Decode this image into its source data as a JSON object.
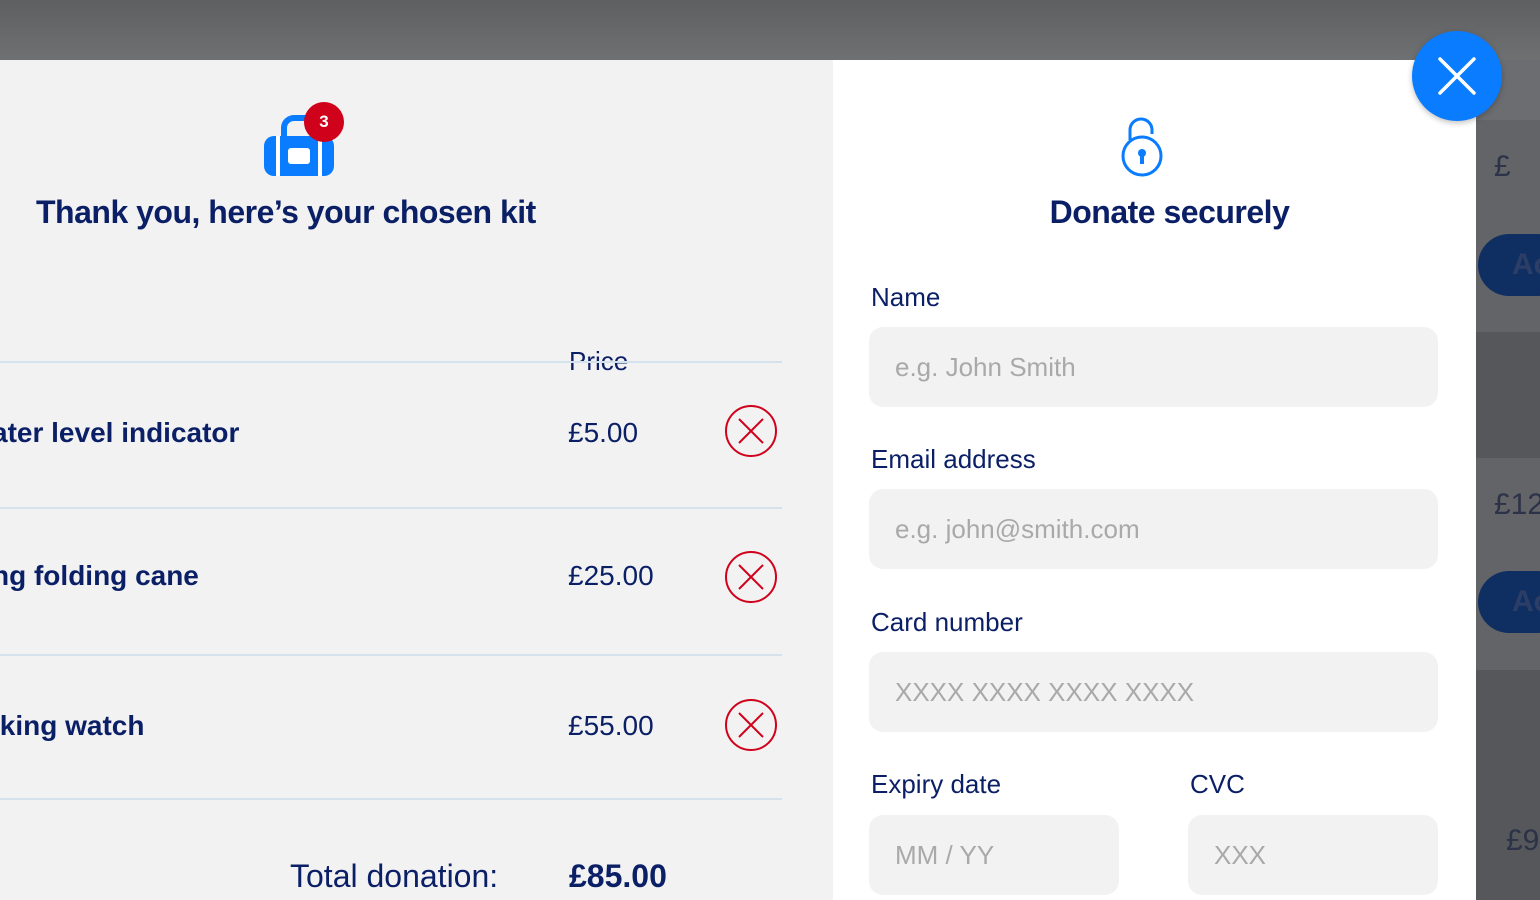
{
  "background": {
    "texts": [
      "£",
      "£12",
      "£9"
    ],
    "buttons": [
      "Ac",
      "Ac"
    ]
  },
  "kit": {
    "badge_count": "3",
    "title": "Thank you, here’s your chosen kit",
    "price_header": "Price",
    "items": [
      {
        "name": "ater level indicator",
        "price": "£5.00"
      },
      {
        "name": "ng folding cane",
        "price": "£25.00"
      },
      {
        "name": "lking watch",
        "price": "£55.00"
      }
    ],
    "total_label": "Total donation:",
    "total_value": "£85.00"
  },
  "donate": {
    "title": "Donate securely",
    "name_label": "Name",
    "name_placeholder": "e.g. John Smith",
    "email_label": "Email address",
    "email_placeholder": "e.g. john@smith.com",
    "card_label": "Card number",
    "card_placeholder": "XXXX XXXX XXXX XXXX",
    "expiry_label": "Expiry date",
    "expiry_placeholder": "MM / YY",
    "cvc_label": "CVC",
    "cvc_placeholder": "XXX"
  },
  "icons": {
    "close": "close-icon",
    "remove": "remove-circle-icon",
    "bag": "kit-bag-icon",
    "lock": "padlock-icon"
  },
  "colors": {
    "primary_navy": "#0b1f66",
    "accent_blue": "#0a7cff",
    "remove_red": "#d0021b"
  }
}
